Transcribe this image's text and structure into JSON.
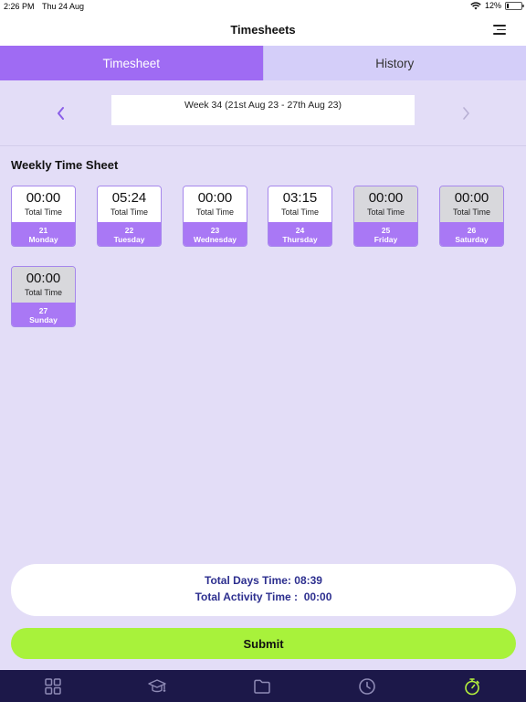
{
  "status": {
    "time": "2:26 PM",
    "date": "Thu 24 Aug",
    "battery": "12%"
  },
  "header": {
    "title": "Timesheets"
  },
  "tabs": [
    {
      "label": "Timesheet",
      "active": true
    },
    {
      "label": "History",
      "active": false
    }
  ],
  "week": {
    "label": "Week 34 (21st Aug 23 - 27th Aug 23)"
  },
  "section_title": "Weekly Time Sheet",
  "days": [
    {
      "time": "00:00",
      "label": "Total Time",
      "date": "21",
      "day": "Monday"
    },
    {
      "time": "05:24",
      "label": "Total Time",
      "date": "22",
      "day": "Tuesday"
    },
    {
      "time": "00:00",
      "label": "Total Time",
      "date": "23",
      "day": "Wednesday"
    },
    {
      "time": "03:15",
      "label": "Total Time",
      "date": "24",
      "day": "Thursday"
    },
    {
      "time": "00:00",
      "label": "Total Time",
      "date": "25",
      "day": "Friday"
    },
    {
      "time": "00:00",
      "label": "Total Time",
      "date": "26",
      "day": "Saturday"
    },
    {
      "time": "00:00",
      "label": "Total Time",
      "date": "27",
      "day": "Sunday"
    }
  ],
  "totals": {
    "days_time": "Total Days Time: 08:39",
    "activity_time": "Total Activity Time :  00:00"
  },
  "submit_label": "Submit",
  "bottom_nav": [
    {
      "icon": "grid-icon"
    },
    {
      "icon": "graduation-cap-icon"
    },
    {
      "icon": "folder-icon"
    },
    {
      "icon": "clock-icon"
    },
    {
      "icon": "stopwatch-icon",
      "active": true
    }
  ],
  "colors": {
    "accent": "#9f6bf3",
    "submit": "#a8f23b",
    "nav_bg": "#1c1849",
    "active_nav_icon": "#b4f03c",
    "totals_text": "#2d2f8f"
  }
}
